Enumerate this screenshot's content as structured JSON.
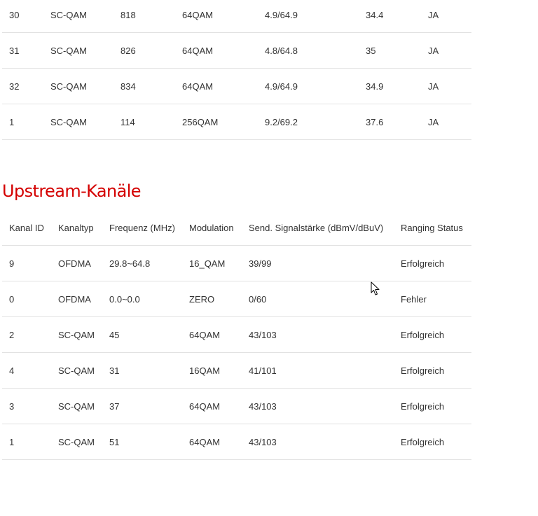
{
  "downstream": {
    "rows": [
      [
        "30",
        "SC-QAM",
        "818",
        "64QAM",
        "4.9/64.9",
        "34.4",
        "JA"
      ],
      [
        "31",
        "SC-QAM",
        "826",
        "64QAM",
        "4.8/64.8",
        "35",
        "JA"
      ],
      [
        "32",
        "SC-QAM",
        "834",
        "64QAM",
        "4.9/64.9",
        "34.9",
        "JA"
      ],
      [
        "1",
        "SC-QAM",
        "114",
        "256QAM",
        "9.2/69.2",
        "37.6",
        "JA"
      ]
    ]
  },
  "upstream": {
    "title": "Upstream-Kanäle",
    "headers": [
      "Kanal ID",
      "Kanaltyp",
      "Frequenz (MHz)",
      "Modulation",
      "Send. Signalstärke (dBmV/dBuV)",
      "Ranging Status"
    ],
    "rows": [
      [
        "9",
        "OFDMA",
        "29.8~64.8",
        "16_QAM",
        "39/99",
        "Erfolgreich"
      ],
      [
        "0",
        "OFDMA",
        "0.0~0.0",
        "ZERO",
        "0/60",
        "Fehler"
      ],
      [
        "2",
        "SC-QAM",
        "45",
        "64QAM",
        "43/103",
        "Erfolgreich"
      ],
      [
        "4",
        "SC-QAM",
        "31",
        "16QAM",
        "41/101",
        "Erfolgreich"
      ],
      [
        "3",
        "SC-QAM",
        "37",
        "64QAM",
        "43/103",
        "Erfolgreich"
      ],
      [
        "1",
        "SC-QAM",
        "51",
        "64QAM",
        "43/103",
        "Erfolgreich"
      ]
    ]
  },
  "colors": {
    "heading": "#d40000",
    "text": "#333333",
    "divider": "#e2e2e2"
  },
  "icons": {
    "cursor": "mouse-pointer-icon"
  }
}
